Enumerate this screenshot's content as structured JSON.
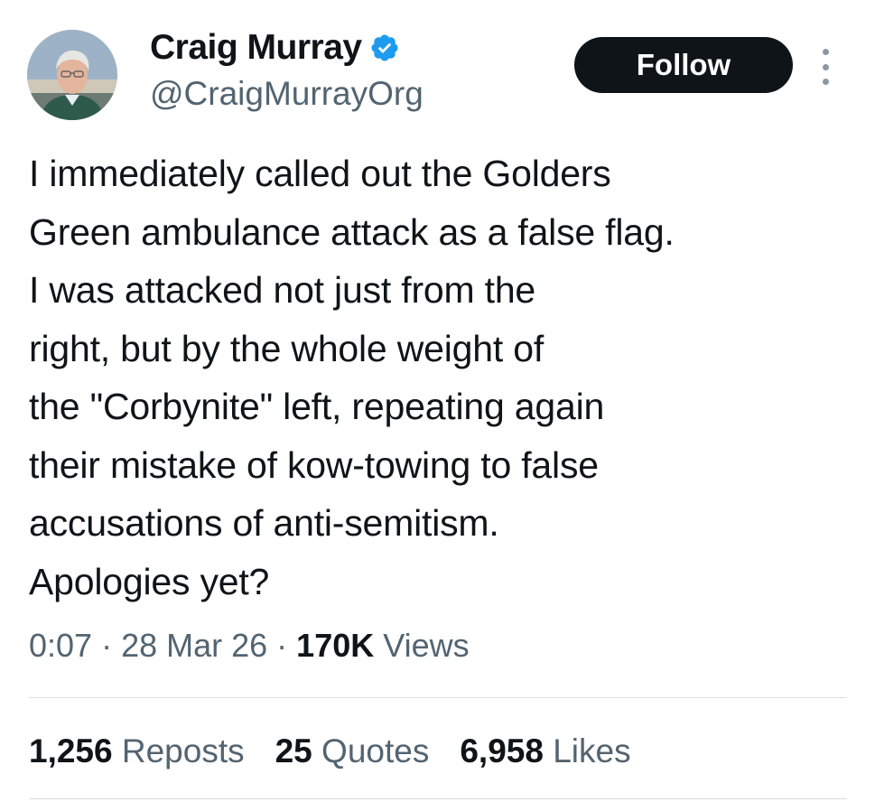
{
  "author": {
    "name": "Craig Murray",
    "handle": "@CraigMurrayOrg",
    "verified": true
  },
  "follow_button": {
    "label": "Follow"
  },
  "tweet": {
    "text": "I immediately called out the Golders\nGreen ambulance attack as a false flag.\nI was attacked not just from the\nright, but by the whole weight of\nthe \"Corbynite\" left, repeating again\ntheir mistake of kow-towing to false\naccusations of anti-semitism.\nApologies yet?"
  },
  "meta": {
    "time": "0:07",
    "separator": " · ",
    "date": "28 Mar 26",
    "views_count": "170K",
    "views_label": "Views"
  },
  "stats": {
    "reposts": {
      "count": "1,256",
      "label": "Reposts"
    },
    "quotes": {
      "count": "25",
      "label": "Quotes"
    },
    "likes": {
      "count": "6,958",
      "label": "Likes"
    }
  },
  "colors": {
    "verified_badge": "#1d9bf0",
    "follow_bg": "#0f1419",
    "secondary_text": "#536471"
  },
  "icons": {
    "verified": "verified-badge-icon",
    "more": "more-options-icon"
  }
}
